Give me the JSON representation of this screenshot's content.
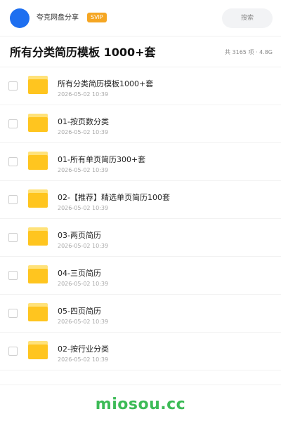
{
  "header": {
    "sharer_name": "夸克网盘分享",
    "badge": "SVIP",
    "search_label": "搜索",
    "avatar_color": "#1e6ff0"
  },
  "folder": {
    "title": "所有分类简历模板 1000+套",
    "meta": "共 3165 项 · 4.8G"
  },
  "items": [
    {
      "name": "所有分类简历模板1000+套",
      "date": "2026-05-02 10:39"
    },
    {
      "name": "01-按页数分类",
      "date": "2026-05-02 10:39"
    },
    {
      "name": "01-所有单页简历300+套",
      "date": "2026-05-02 10:39"
    },
    {
      "name": "02-【推荐】精选单页简历100套",
      "date": "2026-05-02 10:39"
    },
    {
      "name": "03-两页简历",
      "date": "2026-05-02 10:39"
    },
    {
      "name": "04-三页简历",
      "date": "2026-05-02 10:39"
    },
    {
      "name": "05-四页简历",
      "date": "2026-05-02 10:39"
    },
    {
      "name": "02-按行业分类",
      "date": "2026-05-02 10:39"
    }
  ],
  "footer": {
    "watermark": "miosou.cc",
    "watermark_color": "#3dbb57"
  },
  "icons": {
    "folder": "folder-icon",
    "checkbox": "checkbox-icon"
  }
}
